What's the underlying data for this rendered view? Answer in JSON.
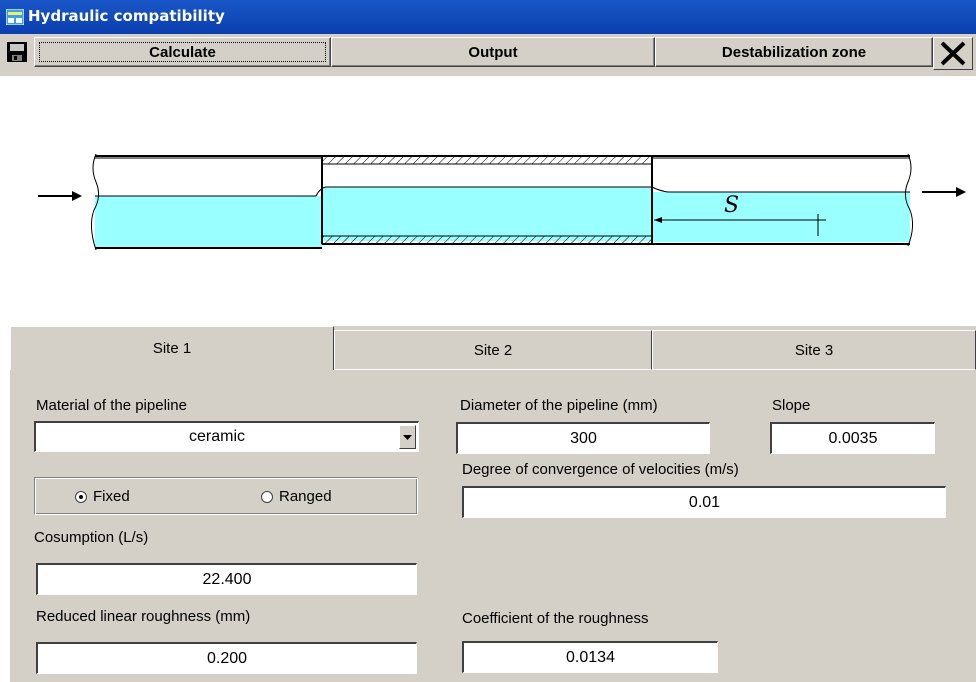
{
  "window": {
    "title": "Hydraulic compatibility"
  },
  "toolbar": {
    "calculate_label": "Calculate",
    "output_label": "Output",
    "destabilization_label": "Destabilization zone"
  },
  "diagram": {
    "distance_symbol": "S"
  },
  "tabs": [
    {
      "label": "Site 1",
      "active": true
    },
    {
      "label": "Site 2",
      "active": false
    },
    {
      "label": "Site 3",
      "active": false
    }
  ],
  "form": {
    "material": {
      "label": "Material of the pipeline",
      "value": "ceramic"
    },
    "diameter": {
      "label": "Diameter of the pipeline (mm)",
      "value": "300"
    },
    "slope": {
      "label": "Slope",
      "value": "0.0035"
    },
    "convergence": {
      "label": "Degree of convergence of velocities (m/s)",
      "value": "0.01"
    },
    "mode": {
      "fixed_label": "Fixed",
      "ranged_label": "Ranged",
      "selected": "Fixed"
    },
    "consumption": {
      "label": "Cosumption (L/s)",
      "value": "22.400"
    },
    "reduced_roughness": {
      "label": "Reduced linear roughness (mm)",
      "value": "0.200"
    },
    "roughness_coefficient": {
      "label": "Coefficient of the roughness",
      "value": "0.0134"
    }
  },
  "colors": {
    "titlebar": "#0a3fae",
    "water": "#99ffff",
    "panel": "#d4d0c8"
  },
  "icons": [
    "app-icon",
    "save-icon",
    "close-icon",
    "dropdown-arrow-icon"
  ]
}
